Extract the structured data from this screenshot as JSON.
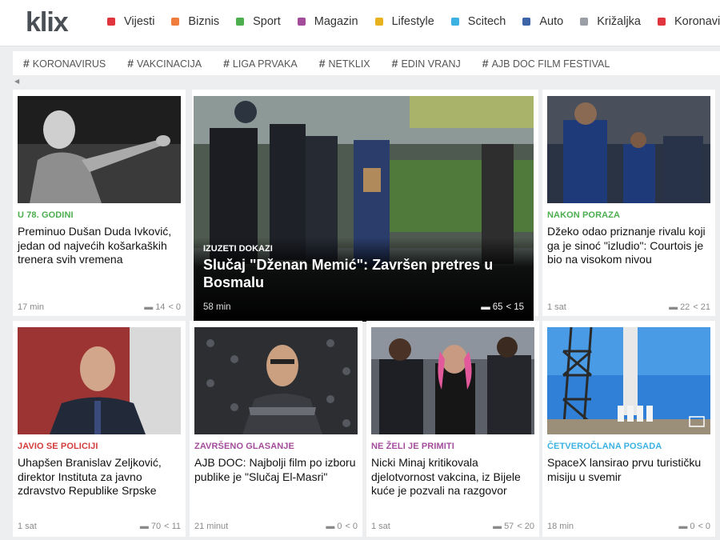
{
  "logo": {
    "text": "klix"
  },
  "nav": {
    "items": [
      {
        "label": "Vijesti",
        "color": "#e2343d"
      },
      {
        "label": "Biznis",
        "color": "#f07d3d"
      },
      {
        "label": "Sport",
        "color": "#4cae4f"
      },
      {
        "label": "Magazin",
        "color": "#a34c9c"
      },
      {
        "label": "Lifestyle",
        "color": "#e8b21f"
      },
      {
        "label": "Scitech",
        "color": "#3cb2e3"
      },
      {
        "label": "Auto",
        "color": "#3e64a8"
      },
      {
        "label": "Križaljka",
        "color": "#9aa0a6"
      },
      {
        "label": "Koronavirus",
        "color": "#e2343d"
      }
    ]
  },
  "tags": {
    "hash": "#",
    "items": [
      "KORONAVIRUS",
      "VAKCINACIJA",
      "LIGA PRVAKA",
      "NETKLIX",
      "EDIN VRANJ",
      "AJB DOC FILM FESTIVAL"
    ]
  },
  "featured": {
    "kicker": "IZUZETI DOKAZI",
    "title": "Slučaj \"Dženan Memić\": Završen pretres u Bosmalu",
    "time": "58 min",
    "comments": "65",
    "shares": "15"
  },
  "articles": [
    {
      "kicker": "U 78. GODINI",
      "kicker_color": "#4cae4f",
      "title": "Preminuo Dušan Duda Ivković, jedan od najvećih košarkaških trenera svih vremena",
      "time": "17 min",
      "comments": "14",
      "shares": "0"
    },
    {
      "kicker": "NAKON PORAZA",
      "kicker_color": "#4cae4f",
      "title": "Džeko odao priznanje rivalu koji ga je sinoć \"izludio\": Courtois je bio na visokom nivou",
      "time": "1 sat",
      "comments": "22",
      "shares": "21"
    },
    {
      "kicker": "JAVIO SE POLICIJI",
      "kicker_color": "#d33b3b",
      "title": "Uhapšen Branislav Zeljković, direktor Instituta za javno zdravstvo Republike Srpske",
      "time": "1 sat",
      "comments": "70",
      "shares": "11"
    },
    {
      "kicker": "ZAVRŠENO GLASANJE",
      "kicker_color": "#a34c9c",
      "title": "AJB DOC: Najbolji film po izboru publike je \"Slučaj El-Masri\"",
      "time": "21 minut",
      "comments": "0",
      "shares": "0"
    },
    {
      "kicker": "NE ŽELI JE PRIMITI",
      "kicker_color": "#a34c9c",
      "title": "Nicki Minaj kritikovala djelotvornost vakcina, iz Bijele kuće je pozvali na razgovor",
      "time": "1 sat",
      "comments": "57",
      "shares": "20"
    },
    {
      "kicker": "ČETVEROČLANA POSADA",
      "kicker_color": "#3cb2e3",
      "title": "SpaceX lansirao prvu turističku misiju u svemir",
      "time": "18 min",
      "comments": "0",
      "shares": "0"
    }
  ]
}
